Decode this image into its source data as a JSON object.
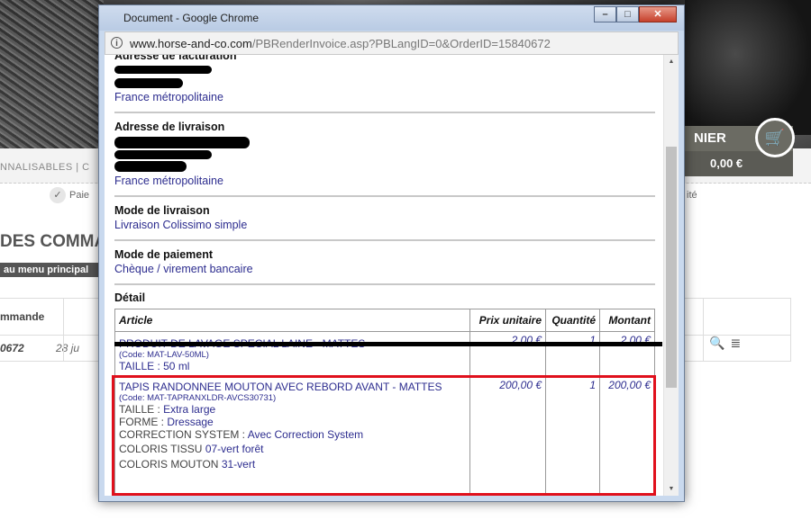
{
  "background": {
    "nav_text": "NNALISABLES  |   C",
    "panier_label": "NIER",
    "panier_price": "0,00 €",
    "step_left": "Paie",
    "step_right": "ité",
    "page_title": "DES COMMAN",
    "menu_button": "au menu principal",
    "table_header": "mmande",
    "order_number": "0672",
    "order_date": "28 ju"
  },
  "window": {
    "title": "Document - Google Chrome",
    "url_host": "www.horse-and-co.com",
    "url_path": "/PBRenderInvoice.asp?PBLangID=0&OrderID=15840672",
    "btn_min": "–",
    "btn_max": "□",
    "btn_close": "✕"
  },
  "invoice": {
    "billing_label": "Adresse de facturation",
    "billing_country": "France métropolitaine",
    "shipping_label": "Adresse de livraison",
    "shipping_country": "France métropolitaine",
    "delivery_mode_label": "Mode de livraison",
    "delivery_mode_value": "Livraison Colissimo simple",
    "payment_mode_label": "Mode de paiement",
    "payment_mode_value": "Chèque / virement bancaire",
    "detail_label": "Détail",
    "columns": [
      "Article",
      "Prix unitaire",
      "Quantité",
      "Montant"
    ],
    "items": [
      {
        "name": "PRODUIT DE LAVAGE SPECIAL LAINE - MATTES",
        "code": "(Code: MAT-LAV-50ML)",
        "attrs": [
          "TAILLE : 50 ml"
        ],
        "price": "2,00 €",
        "qty": "1",
        "amount": "2,00 €"
      },
      {
        "name": "TAPIS RANDONNEE MOUTON AVEC REBORD AVANT - MATTES",
        "code": "(Code: MAT-TAPRANXLDR-AVCS30731)",
        "attrs": [
          {
            "k": "TAILLE",
            "v": "Extra large"
          },
          {
            "k": "FORME",
            "v": "Dressage"
          },
          {
            "k": "CORRECTION SYSTEM",
            "v": "Avec Correction System"
          },
          {
            "k": "COLORIS TISSU",
            "v": "07-vert forêt"
          },
          {
            "k": "COLORIS MOUTON",
            "v": "31-vert"
          }
        ],
        "price": "200,00 €",
        "qty": "1",
        "amount": "200,00 €"
      }
    ]
  },
  "colors": {
    "link_blue": "#2d2d8f",
    "price_green": "#1e6b1e",
    "highlight_red": "#e0101c"
  }
}
